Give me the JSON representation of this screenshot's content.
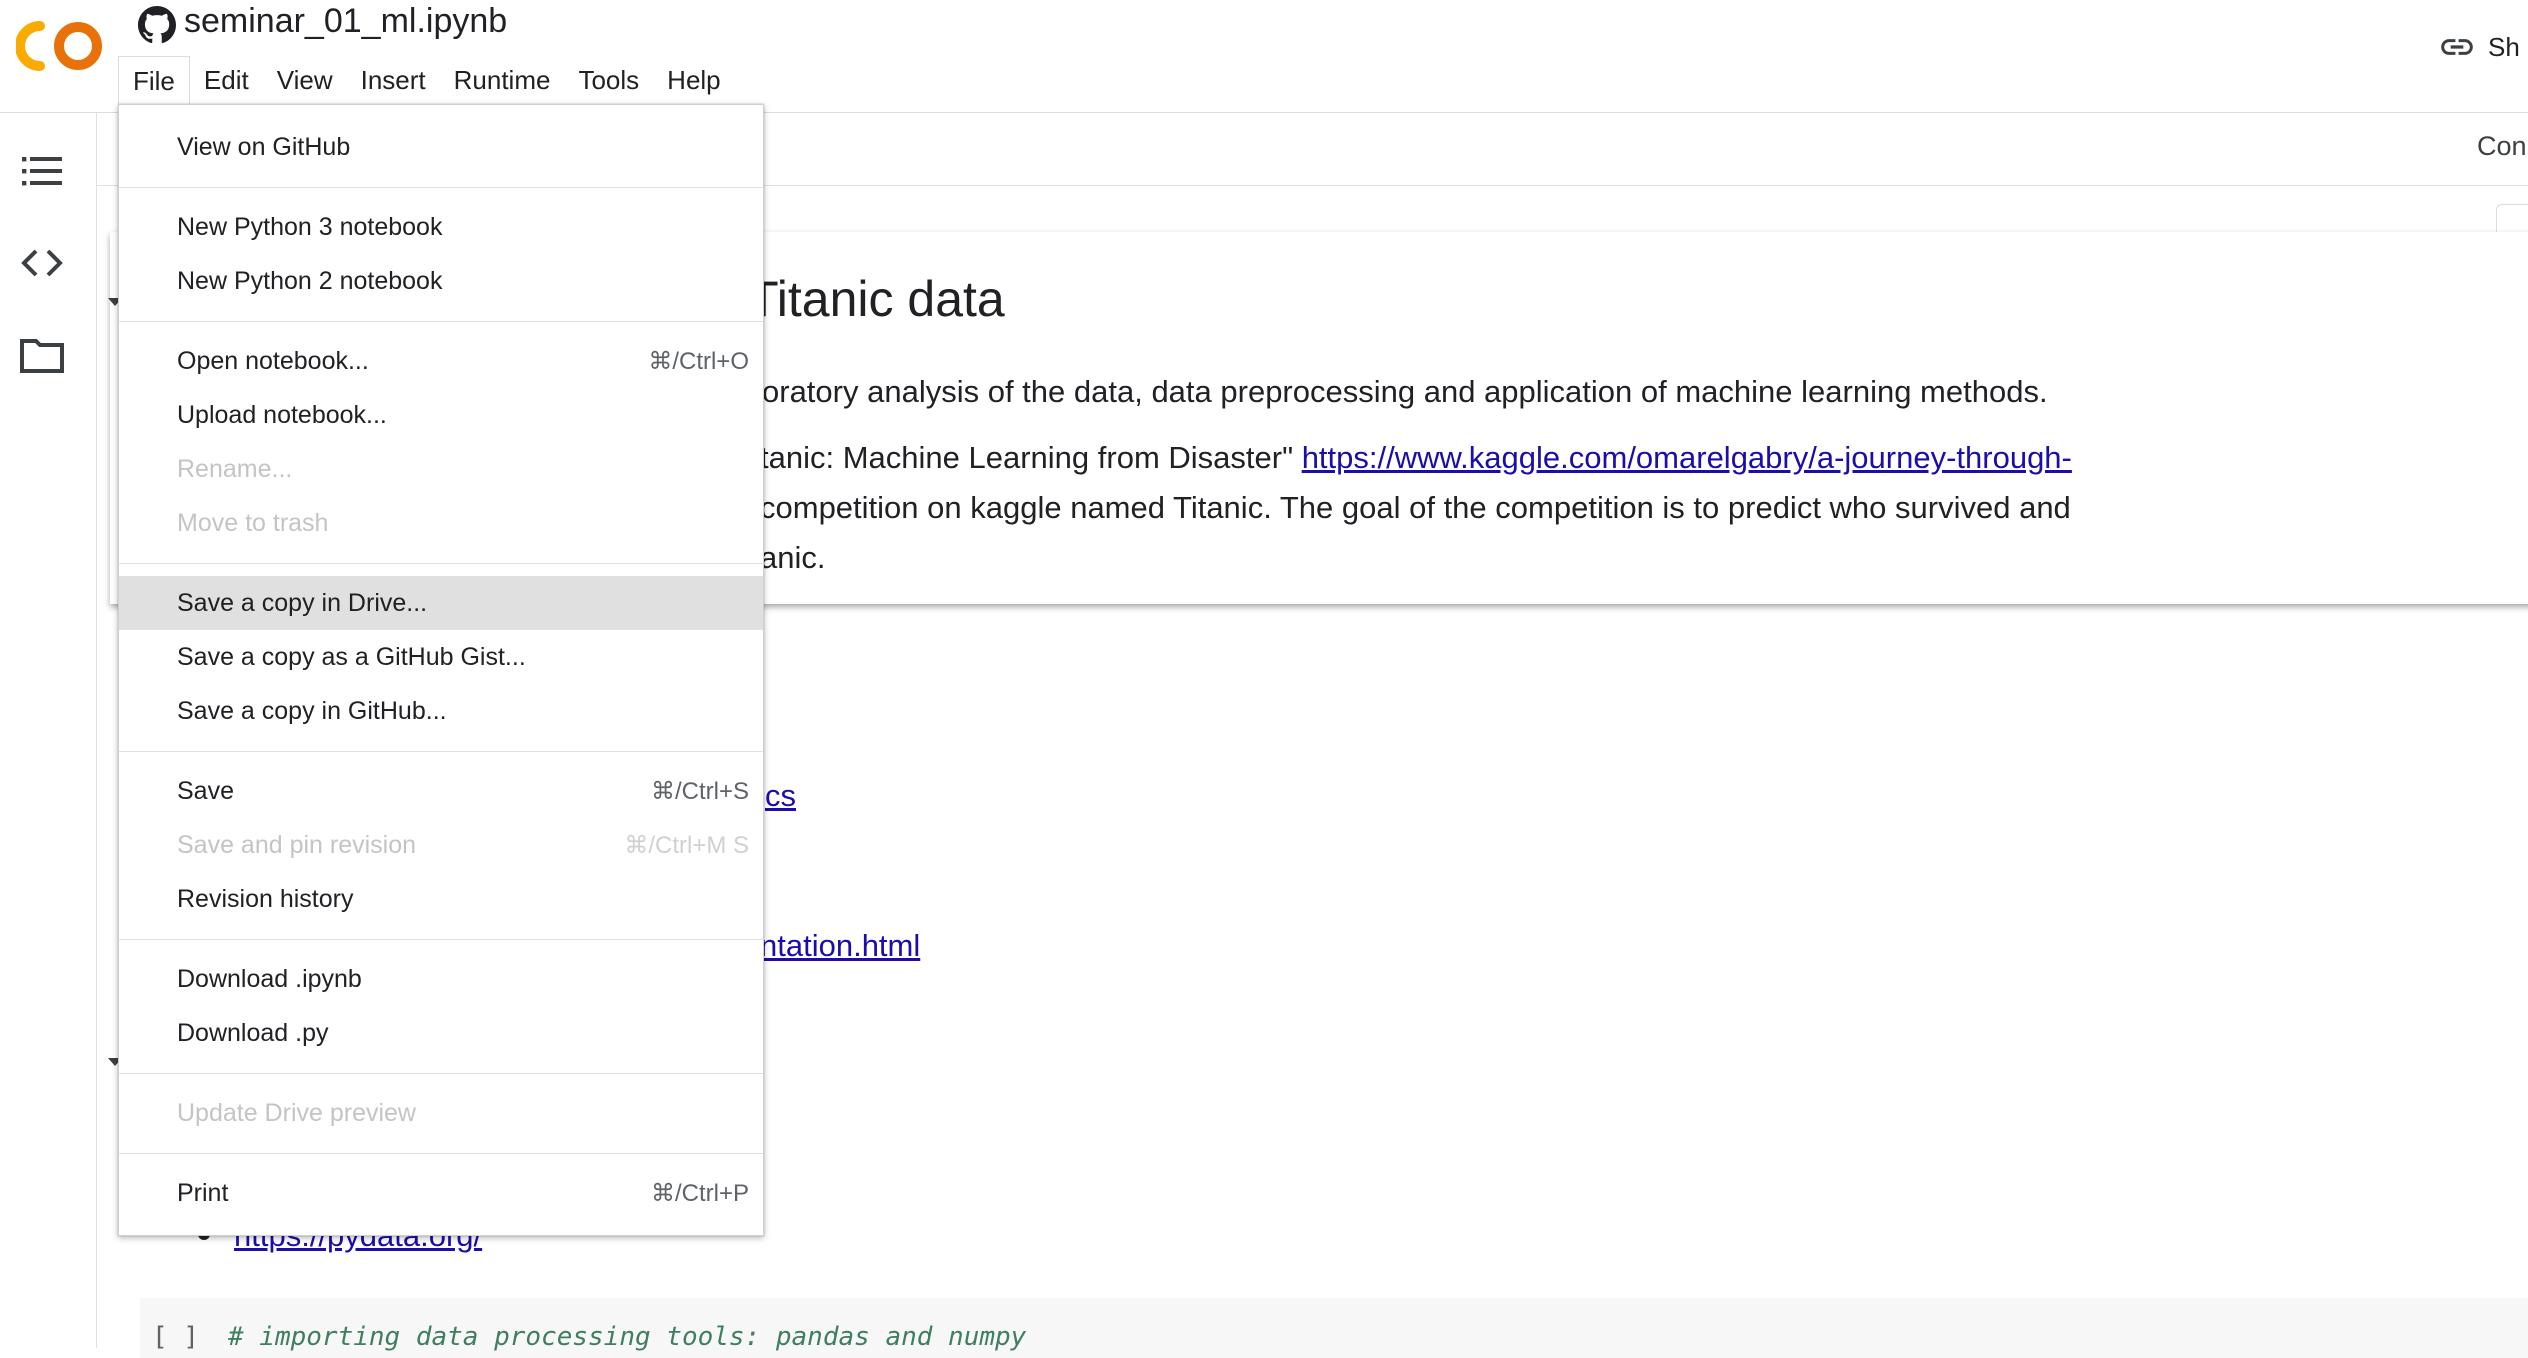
{
  "app": {
    "notebook_title": "seminar_01_ml.ipynb"
  },
  "menubar": [
    "File",
    "Edit",
    "View",
    "Insert",
    "Runtime",
    "Tools",
    "Help"
  ],
  "share": {
    "label": "Sh"
  },
  "toolbar": {
    "connect_label": "Connect"
  },
  "cell": {
    "heading": "ng on Titanic data",
    "line1": "oratory analysis of the data, data preprocessing and application of machine learning methods.",
    "line2_text": "tanic: Machine Learning from Disaster\" ",
    "line2_link": "https://www.kaggle.com/omarelgabry/a-journey-through-",
    "line3": " competition on kaggle named Titanic. The goal of the competition is to predict who survived and",
    "line4": "anic."
  },
  "content": {
    "link_partial_1": "cs",
    "link_partial_2": "ntation.html",
    "pydata_link": "https://pydata.org/",
    "code_bracket": "[ ]",
    "code_comment": "# importing data processing tools: pandas and numpy"
  },
  "file_menu": {
    "view_github": "View on GitHub",
    "new_py3": "New Python 3 notebook",
    "new_py2": "New Python 2 notebook",
    "open": "Open notebook...",
    "open_sc": "⌘/Ctrl+O",
    "upload": "Upload notebook...",
    "rename": "Rename...",
    "move_trash": "Move to trash",
    "save_copy_drive": "Save a copy in Drive...",
    "save_copy_gist": "Save a copy as a GitHub Gist...",
    "save_copy_github": "Save a copy in GitHub...",
    "save": "Save",
    "save_sc": "⌘/Ctrl+S",
    "save_pin": "Save and pin revision",
    "save_pin_sc": "⌘/Ctrl+M S",
    "revision_history": "Revision history",
    "download_ipynb": "Download .ipynb",
    "download_py": "Download .py",
    "update_preview": "Update Drive preview",
    "print": "Print",
    "print_sc": "⌘/Ctrl+P"
  },
  "colors": {
    "logo_orange": "#f9ab00",
    "link": "#1a0dab",
    "menu_hover": "#e0e0e0"
  }
}
